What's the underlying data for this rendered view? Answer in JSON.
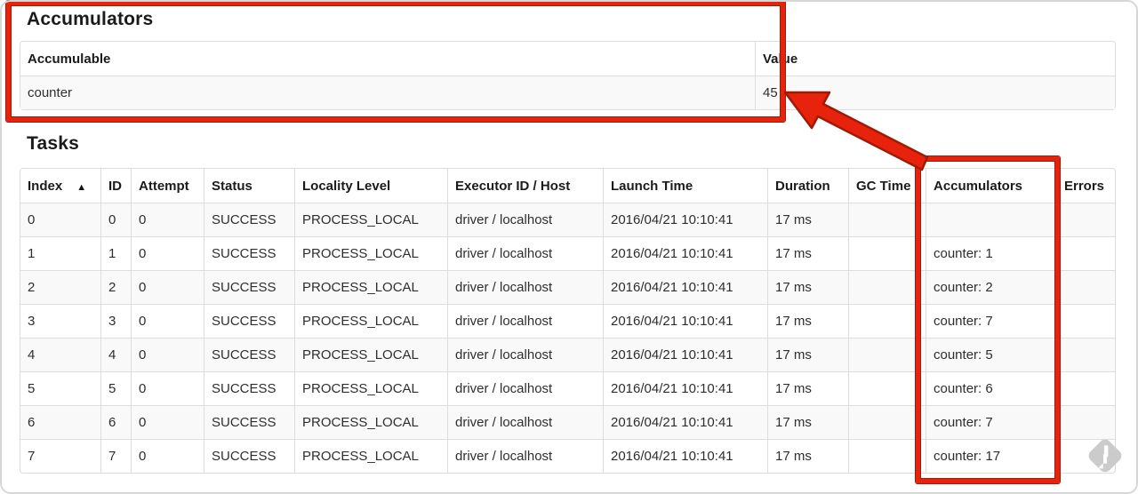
{
  "accumulators_section": {
    "title": "Accumulators",
    "table": {
      "headers": [
        "Accumulable",
        "Value"
      ],
      "row": {
        "name": "counter",
        "value": "45"
      }
    }
  },
  "tasks_section": {
    "title": "Tasks",
    "table": {
      "headers": [
        "Index",
        "ID",
        "Attempt",
        "Status",
        "Locality Level",
        "Executor ID / Host",
        "Launch Time",
        "Duration",
        "GC Time",
        "Accumulators",
        "Errors"
      ],
      "sort": {
        "column": "Index",
        "icon": "▲",
        "direction": "ascending"
      },
      "rows": [
        [
          "0",
          "0",
          "0",
          "SUCCESS",
          "PROCESS_LOCAL",
          "driver / localhost",
          "2016/04/21 10:10:41",
          "17 ms",
          "",
          "",
          ""
        ],
        [
          "1",
          "1",
          "0",
          "SUCCESS",
          "PROCESS_LOCAL",
          "driver / localhost",
          "2016/04/21 10:10:41",
          "17 ms",
          "",
          "counter: 1",
          ""
        ],
        [
          "2",
          "2",
          "0",
          "SUCCESS",
          "PROCESS_LOCAL",
          "driver / localhost",
          "2016/04/21 10:10:41",
          "17 ms",
          "",
          "counter: 2",
          ""
        ],
        [
          "3",
          "3",
          "0",
          "SUCCESS",
          "PROCESS_LOCAL",
          "driver / localhost",
          "2016/04/21 10:10:41",
          "17 ms",
          "",
          "counter: 7",
          ""
        ],
        [
          "4",
          "4",
          "0",
          "SUCCESS",
          "PROCESS_LOCAL",
          "driver / localhost",
          "2016/04/21 10:10:41",
          "17 ms",
          "",
          "counter: 5",
          ""
        ],
        [
          "5",
          "5",
          "0",
          "SUCCESS",
          "PROCESS_LOCAL",
          "driver / localhost",
          "2016/04/21 10:10:41",
          "17 ms",
          "",
          "counter: 6",
          ""
        ],
        [
          "6",
          "6",
          "0",
          "SUCCESS",
          "PROCESS_LOCAL",
          "driver / localhost",
          "2016/04/21 10:10:41",
          "17 ms",
          "",
          "counter: 7",
          ""
        ],
        [
          "7",
          "7",
          "0",
          "SUCCESS",
          "PROCESS_LOCAL",
          "driver / localhost",
          "2016/04/21 10:10:41",
          "17 ms",
          "",
          "counter: 17",
          ""
        ]
      ]
    }
  },
  "annotations": {
    "highlight_color": "#e8230d",
    "highlight_outline_color": "#a01b05",
    "watermark_color": "#cbcbcb"
  }
}
